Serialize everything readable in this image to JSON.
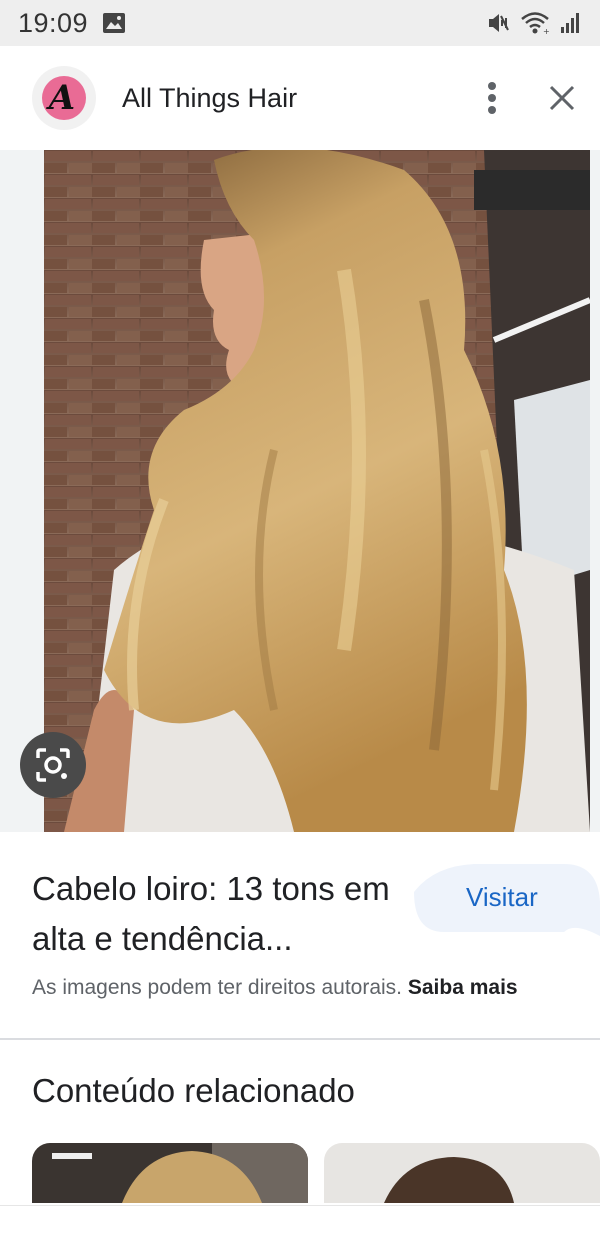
{
  "status_bar": {
    "time": "19:09",
    "icons": [
      "gallery-icon",
      "mute-icon",
      "wifi-icon",
      "signal-icon"
    ]
  },
  "header": {
    "source_name": "All Things Hair",
    "logo_letter": "A",
    "actions": [
      "more-vert-icon",
      "close-icon"
    ]
  },
  "image": {
    "lens_icon": "google-lens-icon"
  },
  "result": {
    "title": "Cabelo loiro: 13 tons em alta e tendência...",
    "visit_label": "Visitar",
    "copyright_text": "As imagens podem ter direitos autorais.",
    "learn_more_label": "Saiba mais"
  },
  "related": {
    "heading": "Conteúdo relacionado"
  },
  "colors": {
    "link_blue": "#1a66c5",
    "logo_pink": "#e96b95",
    "status_bar_bg": "#eeeeee"
  }
}
